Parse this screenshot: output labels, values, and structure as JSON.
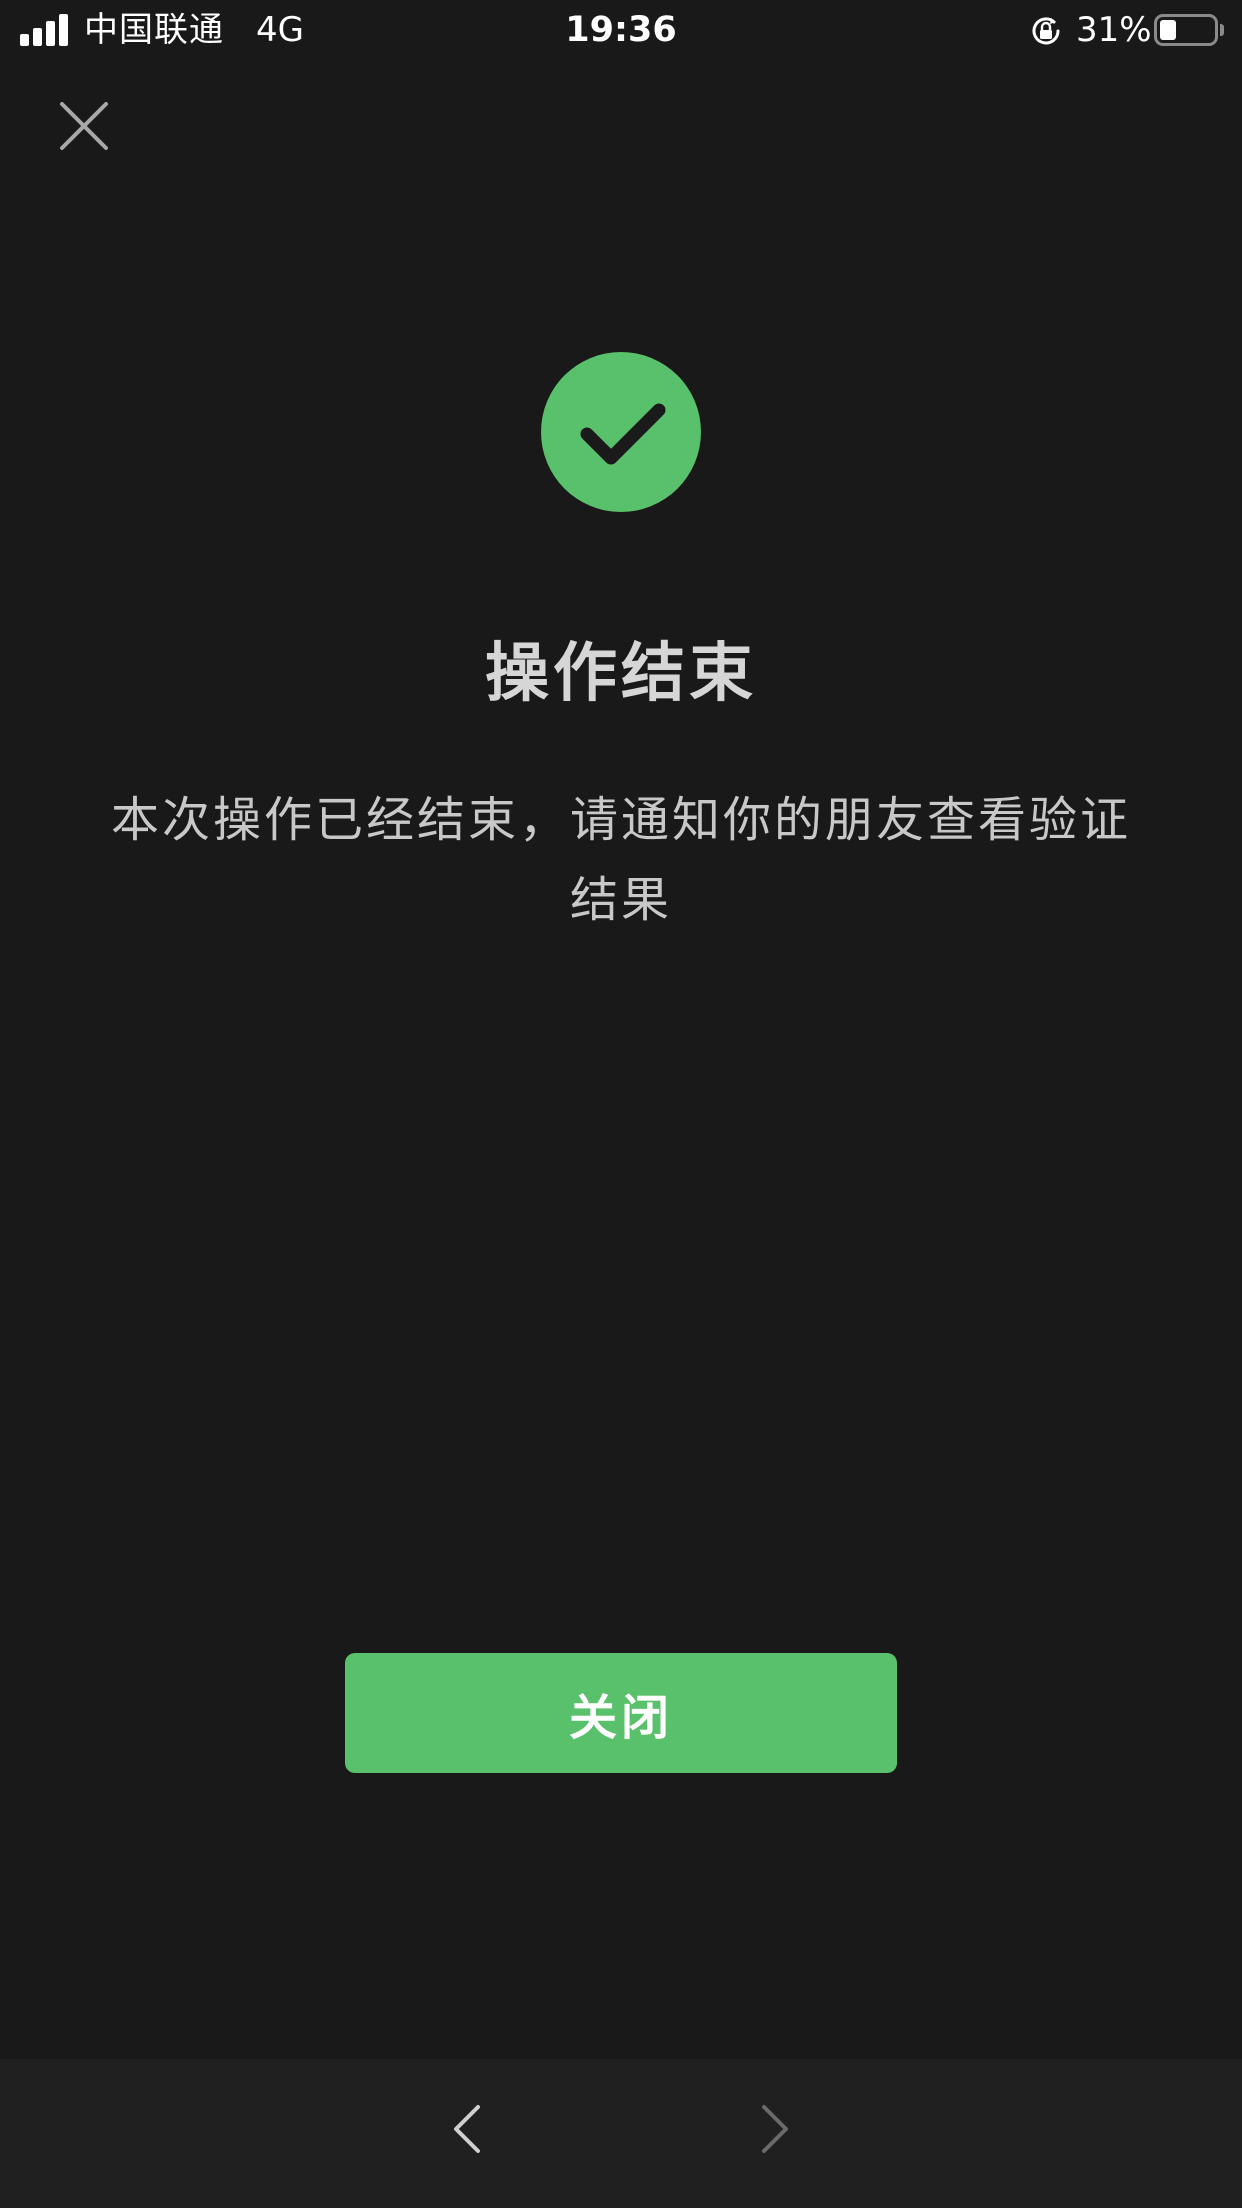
{
  "colors": {
    "background": "#191919",
    "accent": "#59c06b",
    "toolbar": "#202020"
  },
  "status_bar": {
    "carrier": "中国联通",
    "network": "4G",
    "time": "19:36",
    "battery_percent": "31%",
    "battery_level": 0.31,
    "signal_bars": 4,
    "rotation_lock_icon": "rotation-lock-icon"
  },
  "header": {
    "close_icon": "close-icon"
  },
  "result": {
    "status_icon": "checkmark-circle-icon",
    "title": "操作结束",
    "description": "本次操作已经结束，请通知你的朋友查看验证结果"
  },
  "actions": {
    "close_label": "关闭"
  },
  "bottom_toolbar": {
    "back_icon": "chevron-left-icon",
    "forward_icon": "chevron-right-icon",
    "forward_enabled": false
  }
}
